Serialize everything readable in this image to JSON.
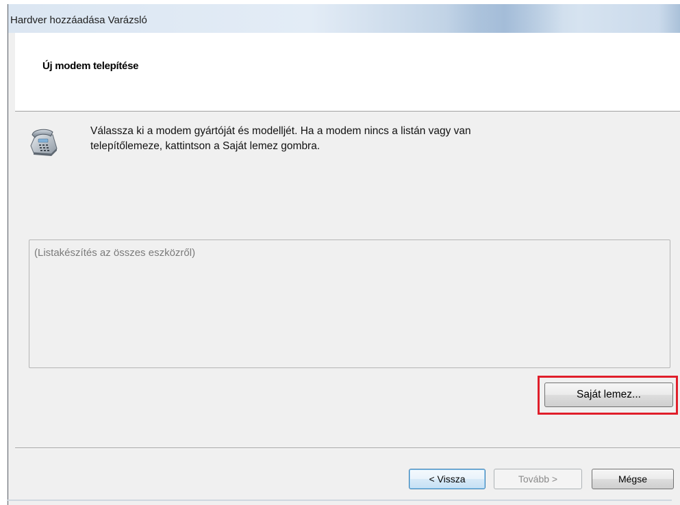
{
  "window": {
    "title": "Hardver hozzáadása Varázsló"
  },
  "header": {
    "title": "Új modem telepítése"
  },
  "description": {
    "line1": "Válassza ki a modem gyártóját és modelljét. Ha a modem nincs a listán vagy van",
    "line2": "telepítőlemeze, kattintson a Saját lemez gombra.",
    "icon": "telephone-modem-icon"
  },
  "device_list": {
    "status_text": "(Listakészítés az összes eszközről)"
  },
  "buttons": {
    "have_disk": "Saját lemez...",
    "back": "< Vissza",
    "next": "Tovább >",
    "cancel": "Mégse"
  },
  "colors": {
    "highlight_border": "#e01e2a",
    "dialog_background": "#f0f0f0"
  }
}
